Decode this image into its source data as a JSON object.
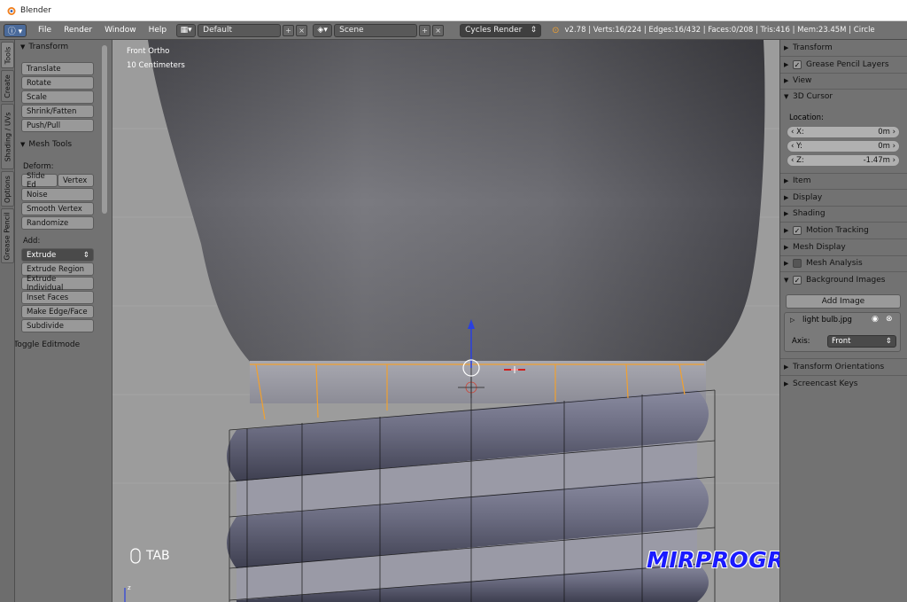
{
  "window": {
    "title": "Blender"
  },
  "header": {
    "menus": [
      "File",
      "Render",
      "Window",
      "Help"
    ],
    "layout": "Default",
    "scene": "Scene",
    "engine": "Cycles Render",
    "stats": "v2.78 | Verts:16/224 | Edges:16/432 | Faces:0/208 | Tris:416 | Mem:23.45M | Circle"
  },
  "tabs": [
    "Tools",
    "Create",
    "Shading / UVs",
    "Options",
    "Grease Pencil"
  ],
  "toolshelf": {
    "transform_title": "Transform",
    "transform_tools": [
      "Translate",
      "Rotate",
      "Scale",
      "Shrink/Fatten",
      "Push/Pull"
    ],
    "mesh_tools_title": "Mesh Tools",
    "deform_label": "Deform:",
    "slide_edge": "Slide Ed",
    "vertex": "Vertex",
    "deform_tools": [
      "Noise",
      "Smooth Vertex",
      "Randomize"
    ],
    "add_label": "Add:",
    "extrude": "Extrude",
    "add_tools": [
      "Extrude Region",
      "Extrude Individual",
      "Inset Faces",
      "Make Edge/Face",
      "Subdivide"
    ],
    "toggle_editmode": "Toggle Editmode"
  },
  "viewport": {
    "view_name": "Front Ortho",
    "grid_scale": "10 Centimeters",
    "key_hint": "TAB",
    "watermark": "MIRPROGRAMM.RU"
  },
  "properties": {
    "transform": "Transform",
    "grease_pencil_layers": "Grease Pencil Layers",
    "view": "View",
    "cursor_title": "3D Cursor",
    "location_label": "Location:",
    "x_label": "X:",
    "x_value": "0m",
    "y_label": "Y:",
    "y_value": "0m",
    "z_label": "Z:",
    "z_value": "-1.47m",
    "item": "Item",
    "display": "Display",
    "shading": "Shading",
    "motion_tracking": "Motion Tracking",
    "mesh_display": "Mesh Display",
    "mesh_analysis": "Mesh Analysis",
    "background_images": "Background Images",
    "add_image": "Add Image",
    "image_name": "light bulb.jpg",
    "axis_label": "Axis:",
    "axis_value": "Front",
    "transform_orientations": "Transform Orientations",
    "screencast_keys": "Screencast Keys"
  },
  "colors": {
    "accent_orange": "#f0a030",
    "watermark_blue": "#1a1aff",
    "ui_panel": "#727272"
  }
}
